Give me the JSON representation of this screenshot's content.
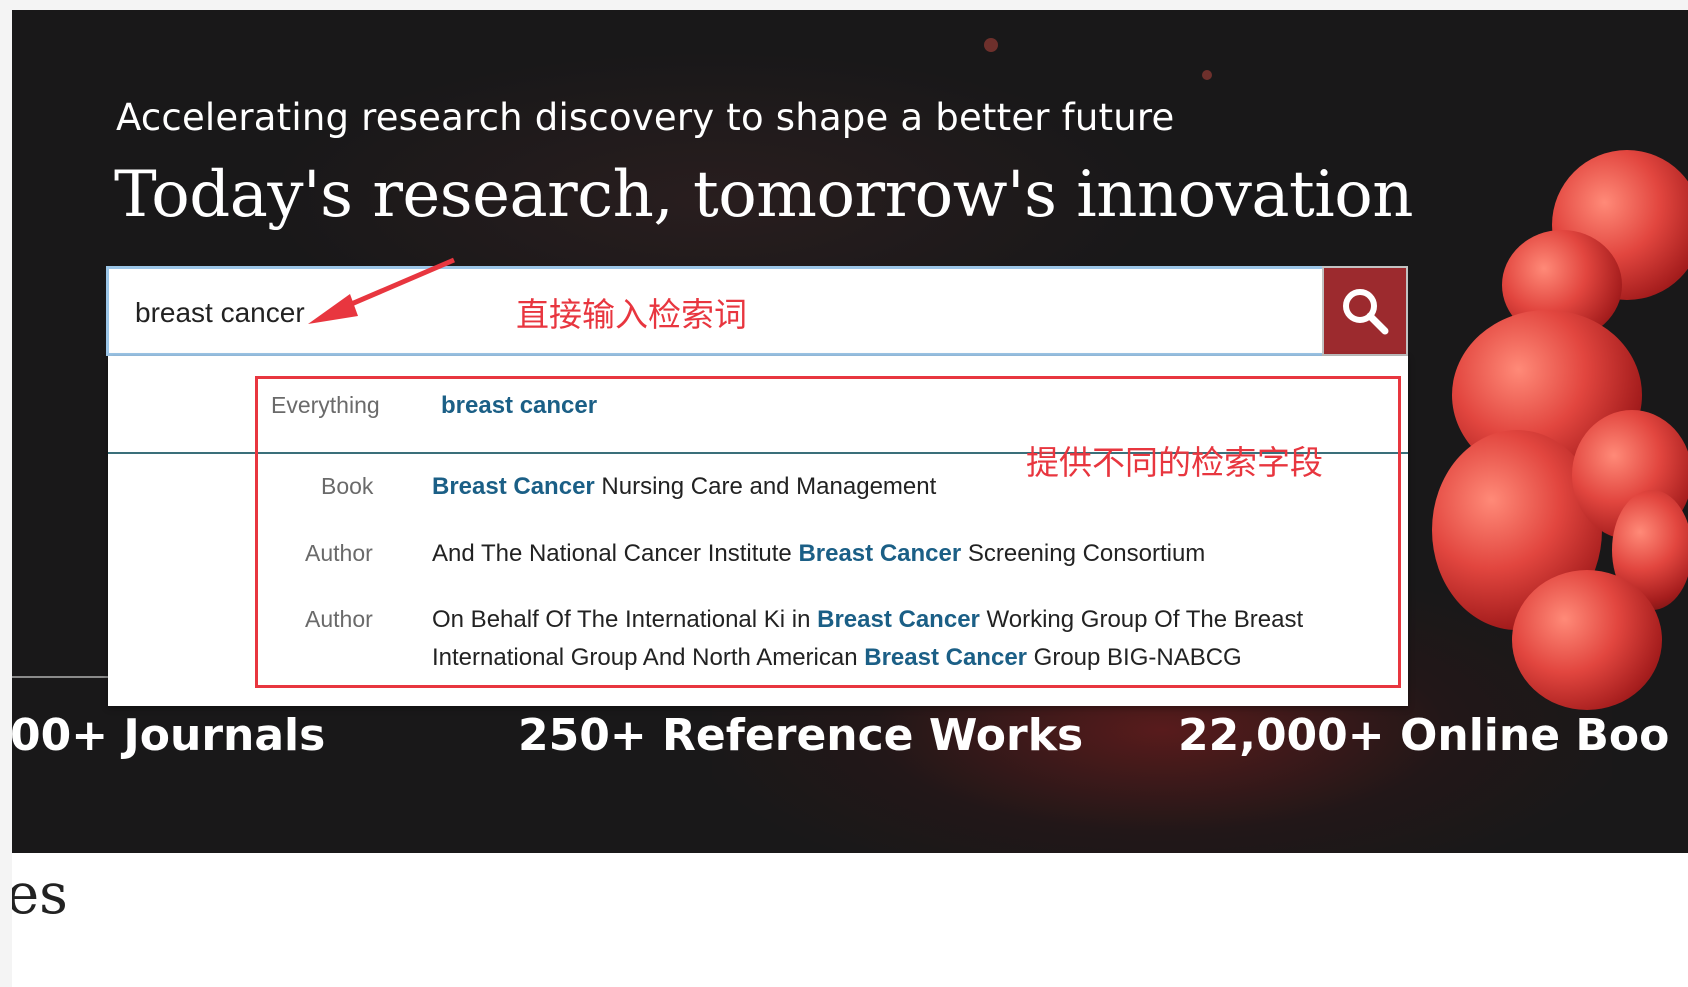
{
  "hero": {
    "tagline": "Accelerating research discovery to shape a better future",
    "headline": "Today's research, tomorrow's innovation"
  },
  "search": {
    "value": "breast cancer",
    "button_icon": "search-icon"
  },
  "suggestions": {
    "everything": {
      "category": "Everything",
      "text": "breast cancer"
    },
    "items": [
      {
        "category": "Book",
        "hl": "Breast Cancer",
        "after": " Nursing Care and Management"
      },
      {
        "category": "Author",
        "before": "And The National Cancer Institute ",
        "hl": "Breast Cancer",
        "after": " Screening Consortium"
      },
      {
        "category": "Author",
        "before": "On Behalf Of The International Ki in ",
        "hl": "Breast Cancer",
        "mid": " Working Group Of The Breast International Group And North American ",
        "hl2": "Breast Cancer",
        "after": " Group BIG-NABCG"
      }
    ]
  },
  "annotations": {
    "input_note": "直接输入检索词",
    "fields_note": "提供不同的检索字段",
    "color": "#e8363f"
  },
  "stats": {
    "journals": "00+ Journals",
    "reference_works": "250+ Reference Works",
    "online_books": "22,000+ Online Boo"
  },
  "below": {
    "partial_heading": "es"
  },
  "colors": {
    "accent": "#9c2a2e",
    "highlight": "#1b5f86",
    "hero_bg": "#191819"
  }
}
